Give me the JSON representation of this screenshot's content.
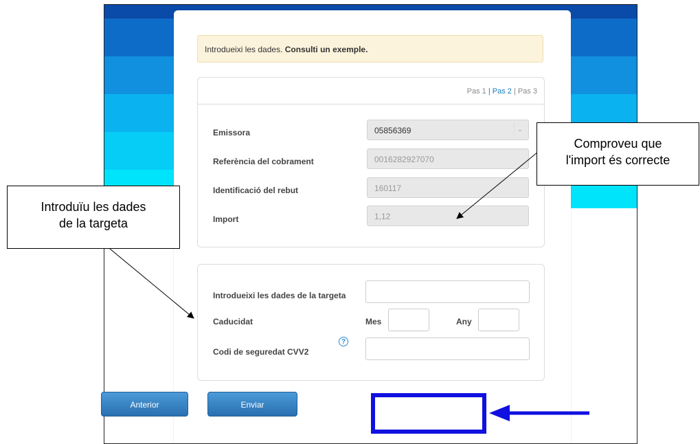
{
  "notice": {
    "text": "Introdueixi les dades.",
    "link": "Consulti un exemple."
  },
  "steps": {
    "s1": "Pas 1",
    "sep1": "|",
    "s2": "Pas 2",
    "sep2": "|",
    "s3": "Pas 3"
  },
  "fields": {
    "emissora_label": "Emissora",
    "emissora_value": "05856369",
    "referencia_label": "Referència del cobrament",
    "referencia_value": "0016282927070",
    "identificacio_label": "Identificació del rebut",
    "identificacio_value": "160117",
    "import_label": "Import",
    "import_value": "1,12"
  },
  "card_form": {
    "targeta_label": "Introdueixi les dades de la targeta",
    "caducitat_label": "Caducidat",
    "mes_label": "Mes",
    "any_label": "Any",
    "cvv_label": "Codi de seguredat CVV2",
    "help_icon": "?"
  },
  "buttons": {
    "anterior": "Anterior",
    "enviar": "Enviar"
  },
  "callouts": {
    "left_line1": "Introduïu les dades",
    "left_line2": "de la targeta",
    "right_line1": "Comproveu que",
    "right_line2": "l'import és correcte"
  },
  "colors": {
    "highlight": "#1010e0",
    "accent": "#1a7bc2",
    "button": "#2a70b0"
  }
}
